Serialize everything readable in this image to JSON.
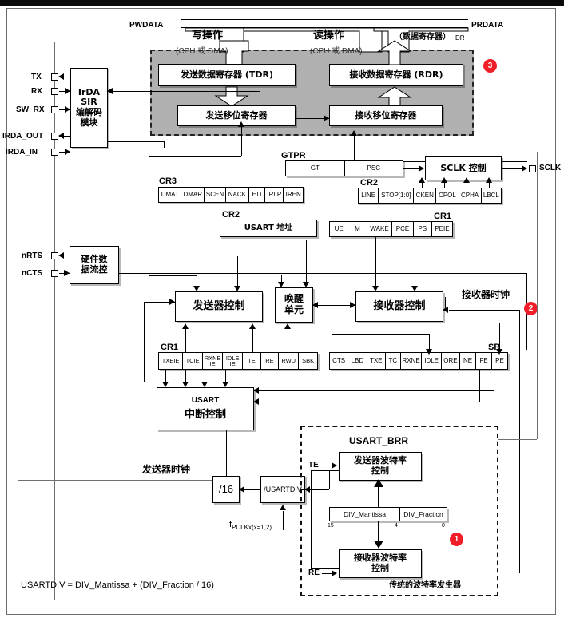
{
  "diagram": {
    "title": "USART block diagram",
    "formula": "USARTDIV = DIV_Mantissa + (DIV_Fraction / 16)",
    "accent_color": "#f01e28",
    "grey_region_color": "#b0b0b0"
  },
  "bus": {
    "pwdata": "PWDATA",
    "prdata": "PRDATA",
    "write_op": "写操作",
    "write_op_sub": "(CPU 或 DMA)",
    "read_op": "读操作",
    "read_op_sub": "(CPU 或 DMA)",
    "data_register": "（数据寄存器）",
    "data_register_dr": "DR"
  },
  "registers_area": {
    "tdr": "发送数据寄存器 (TDR)",
    "rdr": "接收数据寄存器 (RDR)",
    "tx_shift": "发送移位寄存器",
    "rx_shift": "接收移位寄存器"
  },
  "pins": [
    {
      "name": "TX",
      "label": "TX"
    },
    {
      "name": "RX",
      "label": "RX"
    },
    {
      "name": "SW_RX",
      "label": "SW_RX"
    },
    {
      "name": "IRDA_OUT",
      "label": "IRDA_OUT"
    },
    {
      "name": "IRDA_IN",
      "label": "IRDA_IN"
    },
    {
      "name": "nRTS",
      "label": "nRTS"
    },
    {
      "name": "nCTS",
      "label": "nCTS"
    },
    {
      "name": "SCLK",
      "label": "SCLK"
    }
  ],
  "blocks": {
    "irda": "IrDA\nSIR\n编解码\n模块",
    "irda_lines": [
      "IrDA",
      "SIR",
      "编解码",
      "模块"
    ],
    "flow_control": [
      "硬件数",
      "据流控"
    ],
    "tx_control": "发送器控制",
    "rx_control": "接收器控制",
    "wakeup": [
      "唤醒",
      "单元"
    ],
    "usart_interrupt": [
      "USART",
      "中断控制"
    ],
    "sclk_control": "SCLK 控制",
    "usart_address": "USART 地址",
    "div16": "/16",
    "div_usartdiv": "/USARTDIV",
    "tx_baud_control": [
      "发送器波特率",
      "控制"
    ],
    "rx_baud_control": [
      "接收器波特率",
      "控制"
    ]
  },
  "labels": {
    "tx_clock": "发送器时钟",
    "rx_clock": "接收器时钟",
    "fpclk_f": "f",
    "fpclk_sub": "PCLKx(x=1,2)",
    "brr_title": "USART_BRR",
    "brr_caption": "传统的波特率发生器",
    "te": "TE",
    "re": "RE"
  },
  "register_groups": [
    {
      "name": "CR3",
      "label": "CR3",
      "fields": [
        "DMAT",
        "DMAR",
        "SCEN",
        "NACK",
        "HD",
        "IRLP",
        "IREN"
      ]
    },
    {
      "name": "CR2_addr",
      "label": "CR2",
      "fields": [
        "USART 地址"
      ]
    },
    {
      "name": "GTPR",
      "label": "GTPR",
      "fields": [
        "GT",
        "PSC"
      ]
    },
    {
      "name": "CR2",
      "label": "CR2",
      "fields": [
        "LINE",
        "STOP[1:0]",
        "CKEN",
        "CPOL",
        "CPHA",
        "LBCL"
      ]
    },
    {
      "name": "CR1_top",
      "label": "CR1",
      "fields": [
        "UE",
        "M",
        "WAKE",
        "PCE",
        "PS",
        "PEIE"
      ]
    },
    {
      "name": "CR1",
      "label": "CR1",
      "fields": [
        "TXEIE",
        "TCIE",
        "RXNE\nIE",
        "IDLE\nIE",
        "TE",
        "RE",
        "RWU",
        "SBK"
      ]
    },
    {
      "name": "SR",
      "label": "SR",
      "fields": [
        "CTS",
        "LBD",
        "TXE",
        "TC",
        "RXNE",
        "IDLE",
        "ORE",
        "NE",
        "FE",
        "PE"
      ]
    },
    {
      "name": "BRR",
      "label": "",
      "fields": [
        "DIV_Mantissa",
        "DIV_Fraction"
      ],
      "bit_markers": [
        "15",
        "4",
        "0"
      ]
    }
  ],
  "markers": [
    {
      "id": "1",
      "value": "1"
    },
    {
      "id": "2",
      "value": "2"
    },
    {
      "id": "3",
      "value": "3"
    }
  ],
  "cr3_fields": [
    "DMAT",
    "DMAR",
    "SCEN",
    "NACK",
    "HD",
    "IRLP",
    "IREN"
  ],
  "cr2_fields": [
    "LINE",
    "STOP[1:0]",
    "CKEN",
    "CPOL",
    "CPHA",
    "LBCL"
  ],
  "cr1_top_fields": [
    "UE",
    "M",
    "WAKE",
    "PCE",
    "PS",
    "PEIE"
  ],
  "cr1_fields": [
    "TXEIE",
    "TCIE",
    "RXNE IE",
    "IDLE IE",
    "TE",
    "RE",
    "RWU",
    "SBK"
  ],
  "sr_fields": [
    "CTS",
    "LBD",
    "TXE",
    "TC",
    "RXNE",
    "IDLE",
    "ORE",
    "NE",
    "FE",
    "PE"
  ],
  "gtpr_fields": [
    "GT",
    "PSC"
  ],
  "brr_fields": [
    "DIV_Mantissa",
    "DIV_Fraction"
  ],
  "brr_bits": [
    "15",
    "4",
    "0"
  ]
}
